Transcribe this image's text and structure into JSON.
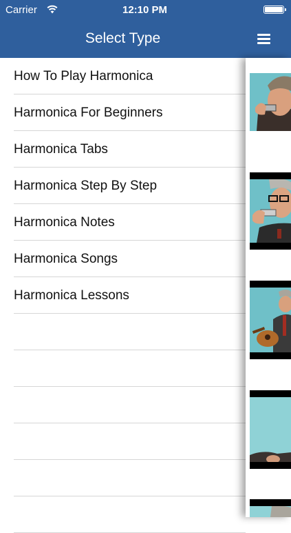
{
  "status_bar": {
    "carrier": "Carrier",
    "time": "12:10 PM",
    "wifi_icon": "wifi-icon",
    "battery_icon": "battery-icon"
  },
  "nav": {
    "title": "Select Type",
    "menu_icon": "hamburger-icon"
  },
  "menu": {
    "items": [
      "How To Play Harmonica",
      "Harmonica For Beginners",
      "Harmonica Tabs",
      "Harmonica Step By Step",
      "Harmonica Notes",
      "Harmonica Songs",
      "Harmonica Lessons",
      "",
      "",
      "",
      "",
      "",
      ""
    ]
  },
  "colors": {
    "nav_background": "#2f5f9d",
    "nav_text": "#ffffff",
    "separator": "#d6d6d6"
  }
}
